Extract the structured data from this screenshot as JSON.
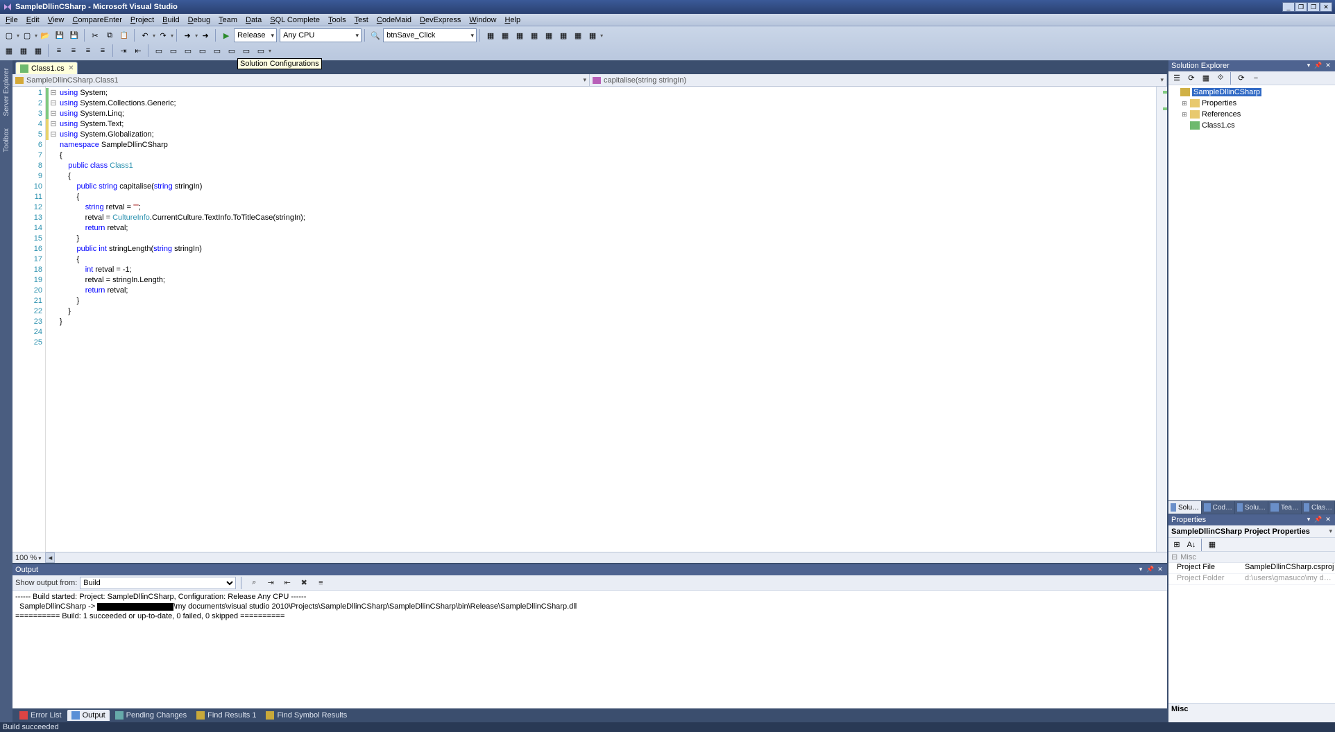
{
  "title": "SampleDllinCSharp - Microsoft Visual Studio",
  "window_buttons": {
    "min": "_",
    "restore": "❐",
    "max": "❐",
    "close": "✕"
  },
  "menu": [
    "File",
    "Edit",
    "View",
    "CompareEnter",
    "Project",
    "Build",
    "Debug",
    "Team",
    "Data",
    "SQL Complete",
    "Tools",
    "Test",
    "CodeMaid",
    "DevExpress",
    "Window",
    "Help"
  ],
  "toolbar": {
    "config_select": "Release",
    "platform_select": "Any CPU",
    "event_select": "btnSave_Click",
    "tooltip": "Solution Configurations"
  },
  "left_tabs": [
    "Server Explorer",
    "Toolbox"
  ],
  "file_tab": {
    "name": "Class1.cs"
  },
  "nav": {
    "class": "SampleDllinCSharp.Class1",
    "member": "capitalise(string stringIn)"
  },
  "code": {
    "lines": [
      {
        "n": 1,
        "fold": "⊟",
        "chg": "g",
        "html": "<span class='kw'>using</span> System;"
      },
      {
        "n": 2,
        "fold": "",
        "chg": "g",
        "html": "<span class='kw'>using</span> System.Collections.Generic;"
      },
      {
        "n": 3,
        "fold": "",
        "chg": "g",
        "html": "<span class='kw'>using</span> System.Linq;"
      },
      {
        "n": 4,
        "fold": "",
        "chg": "y",
        "html": "<span class='kw'>using</span> System.Text;"
      },
      {
        "n": 5,
        "fold": "",
        "chg": "y",
        "html": "<span class='kw'>using</span> System.Globalization;"
      },
      {
        "n": 6,
        "fold": "",
        "chg": "",
        "html": ""
      },
      {
        "n": 7,
        "fold": "⊟",
        "chg": "",
        "html": "<span class='kw'>namespace</span> SampleDllinCSharp"
      },
      {
        "n": 8,
        "fold": "",
        "chg": "",
        "html": "{"
      },
      {
        "n": 9,
        "fold": "⊟",
        "chg": "",
        "html": "    <span class='kw'>public</span> <span class='kw'>class</span> <span class='ty'>Class1</span>"
      },
      {
        "n": 10,
        "fold": "",
        "chg": "",
        "html": "    {"
      },
      {
        "n": 11,
        "fold": "⊟",
        "chg": "",
        "html": "        <span class='kw'>public</span> <span class='kw'>string</span> capitalise(<span class='kw'>string</span> stringIn)"
      },
      {
        "n": 12,
        "fold": "",
        "chg": "",
        "html": "        {"
      },
      {
        "n": 13,
        "fold": "",
        "chg": "",
        "html": "            <span class='kw'>string</span> retval = <span class='st'>\"\"</span>;"
      },
      {
        "n": 14,
        "fold": "",
        "chg": "",
        "html": "            retval = <span class='ty'>CultureInfo</span>.CurrentCulture.TextInfo.ToTitleCase(stringIn);"
      },
      {
        "n": 15,
        "fold": "",
        "chg": "",
        "html": "            <span class='kw'>return</span> retval;"
      },
      {
        "n": 16,
        "fold": "",
        "chg": "",
        "html": "        }"
      },
      {
        "n": 17,
        "fold": "⊟",
        "chg": "",
        "html": "        <span class='kw'>public</span> <span class='kw'>int</span> stringLength(<span class='kw'>string</span> stringIn)"
      },
      {
        "n": 18,
        "fold": "",
        "chg": "",
        "html": "        {"
      },
      {
        "n": 19,
        "fold": "",
        "chg": "",
        "html": "            <span class='kw'>int</span> retval = -1;"
      },
      {
        "n": 20,
        "fold": "",
        "chg": "",
        "html": "            retval = stringIn.Length;"
      },
      {
        "n": 21,
        "fold": "",
        "chg": "",
        "html": "            <span class='kw'>return</span> retval;"
      },
      {
        "n": 22,
        "fold": "",
        "chg": "",
        "html": "        }"
      },
      {
        "n": 23,
        "fold": "",
        "chg": "",
        "html": "    }"
      },
      {
        "n": 24,
        "fold": "",
        "chg": "",
        "html": "}"
      },
      {
        "n": 25,
        "fold": "",
        "chg": "",
        "html": ""
      }
    ],
    "zoom": "100 %"
  },
  "output": {
    "title": "Output",
    "show_label": "Show output from:",
    "show_value": "Build",
    "lines": [
      "------ Build started: Project: SampleDllinCSharp, Configuration: Release Any CPU ------",
      "  SampleDllinCSharp -> [[REDACT]]\\my documents\\visual studio 2010\\Projects\\SampleDllinCSharp\\SampleDllinCSharp\\bin\\Release\\SampleDllinCSharp.dll",
      "========== Build: 1 succeeded or up-to-date, 0 failed, 0 skipped =========="
    ]
  },
  "bottom_tabs": [
    {
      "label": "Error List",
      "icon": "#d44"
    },
    {
      "label": "Output",
      "icon": "#5a8fd6",
      "active": true
    },
    {
      "label": "Pending Changes",
      "icon": "#6aa"
    },
    {
      "label": "Find Results 1",
      "icon": "#c9a93a"
    },
    {
      "label": "Find Symbol Results",
      "icon": "#c9a93a"
    }
  ],
  "solution_explorer": {
    "title": "Solution Explorer",
    "tree": [
      {
        "depth": 0,
        "exp": "",
        "icon": "solution",
        "label": "SampleDllinCSharp",
        "sel": true
      },
      {
        "depth": 1,
        "exp": "⊞",
        "icon": "folder",
        "label": "Properties"
      },
      {
        "depth": 1,
        "exp": "⊞",
        "icon": "folder",
        "label": "References"
      },
      {
        "depth": 1,
        "exp": "",
        "icon": "csfile",
        "label": "Class1.cs"
      }
    ]
  },
  "right_tabs": [
    "Solu…",
    "Cod…",
    "Solu…",
    "Tea…",
    "Clas…"
  ],
  "properties": {
    "title": "Properties",
    "object": "SampleDllinCSharp Project Properties",
    "category": "Misc",
    "rows": [
      {
        "k": "Project File",
        "v": "SampleDllinCSharp.csproj",
        "dim": false
      },
      {
        "k": "Project Folder",
        "v": "d:\\users\\gmasuco\\my documen",
        "dim": true
      }
    ],
    "desc": "Misc"
  },
  "status": "Build succeeded"
}
